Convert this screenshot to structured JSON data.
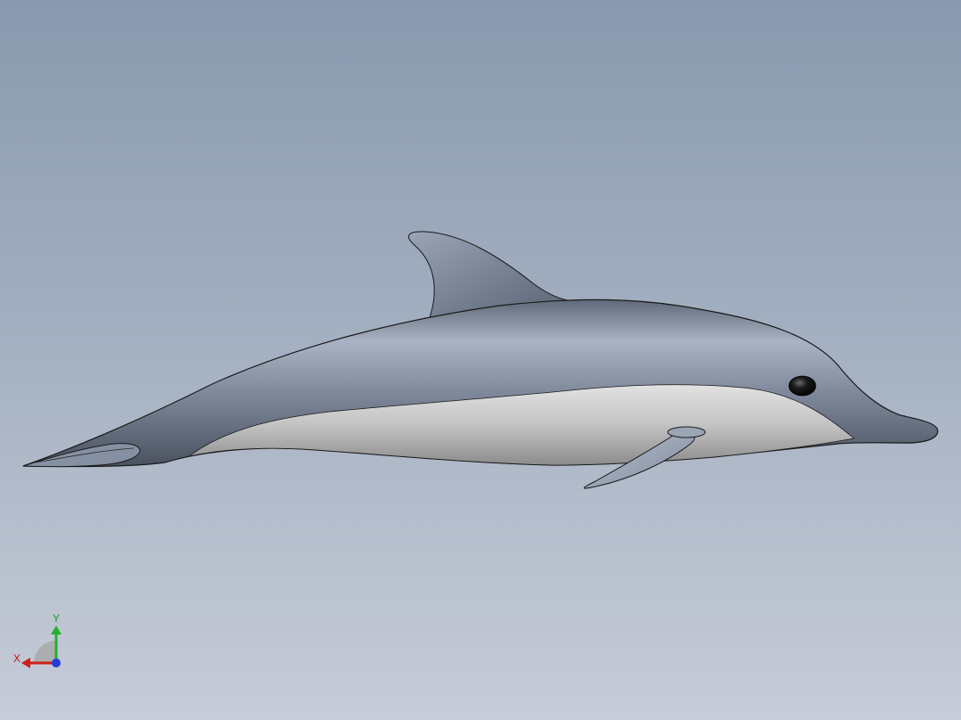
{
  "triad": {
    "x_label": "X",
    "y_label": "Y",
    "colors": {
      "x": "#d0201c",
      "y": "#22b030",
      "z": "#1f3fd8"
    }
  },
  "model": {
    "colors": {
      "body": "#7d8797",
      "belly": "#c9c9c9",
      "outline": "#1a1a1a"
    }
  }
}
